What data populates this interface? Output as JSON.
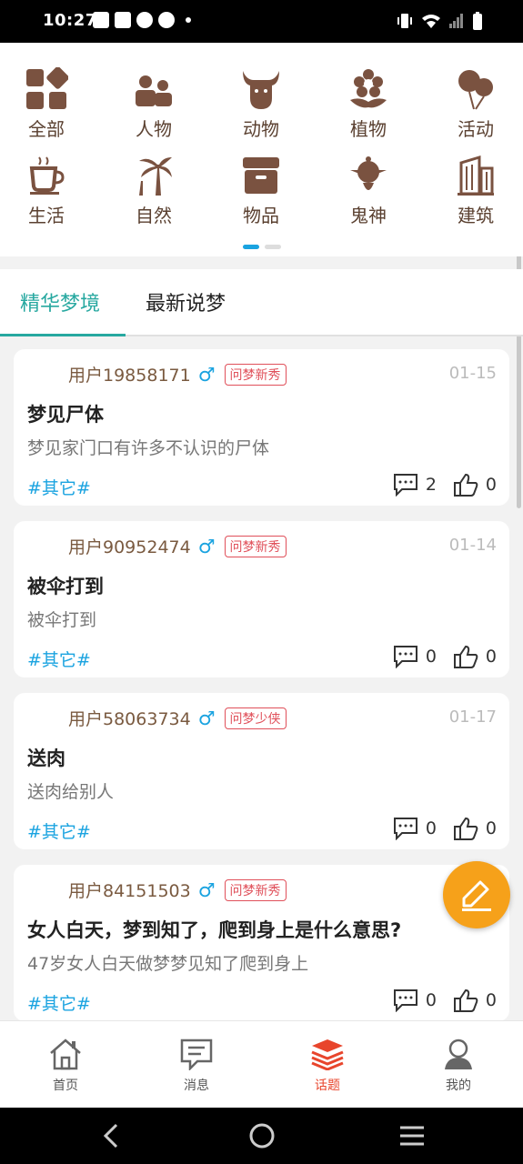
{
  "status_bar": {
    "time": "10:27"
  },
  "categories": [
    {
      "label": "全部",
      "icon": "grid-icon"
    },
    {
      "label": "人物",
      "icon": "people-icon"
    },
    {
      "label": "动物",
      "icon": "bull-icon"
    },
    {
      "label": "植物",
      "icon": "flower-icon"
    },
    {
      "label": "活动",
      "icon": "balloons-icon"
    },
    {
      "label": "生活",
      "icon": "coffee-cup-icon"
    },
    {
      "label": "自然",
      "icon": "palm-tree-icon"
    },
    {
      "label": "物品",
      "icon": "box-icon"
    },
    {
      "label": "鬼神",
      "icon": "spirit-icon"
    },
    {
      "label": "建筑",
      "icon": "building-icon"
    }
  ],
  "tabs": {
    "featured": "精华梦境",
    "latest": "最新说梦"
  },
  "posts": [
    {
      "user": "用户19858171",
      "gender": "♂",
      "badge": "问梦新秀",
      "date": "01-15",
      "title": "梦见尸体",
      "desc": "梦见家门口有许多不认识的尸体",
      "tag": "#其它#",
      "comments": "2",
      "likes": "0"
    },
    {
      "user": "用户90952474",
      "gender": "♂",
      "badge": "问梦新秀",
      "date": "01-14",
      "title": "被伞打到",
      "desc": "被伞打到",
      "tag": "#其它#",
      "comments": "0",
      "likes": "0"
    },
    {
      "user": "用户58063734",
      "gender": "♂",
      "badge": "问梦少侠",
      "date": "01-17",
      "title": "送肉",
      "desc": "送肉给别人",
      "tag": "#其它#",
      "comments": "0",
      "likes": "0"
    },
    {
      "user": "用户84151503",
      "gender": "♂",
      "badge": "问梦新秀",
      "date": "",
      "title": "女人白天，梦到知了，爬到身上是什么意思?",
      "desc": "47岁女人白天做梦梦见知了爬到身上",
      "tag": "#其它#",
      "comments": "0",
      "likes": "0"
    }
  ],
  "bottom_nav": [
    {
      "label": "首页",
      "icon": "home-icon"
    },
    {
      "label": "消息",
      "icon": "message-icon"
    },
    {
      "label": "话题",
      "icon": "topic-layers-icon"
    },
    {
      "label": "我的",
      "icon": "profile-icon"
    }
  ],
  "colors": {
    "accent": "#27a8a0",
    "icon_brown": "#7a5240",
    "fab": "#f6a11a",
    "active_nav": "#e8452c",
    "tag_blue": "#1aa3e0"
  }
}
